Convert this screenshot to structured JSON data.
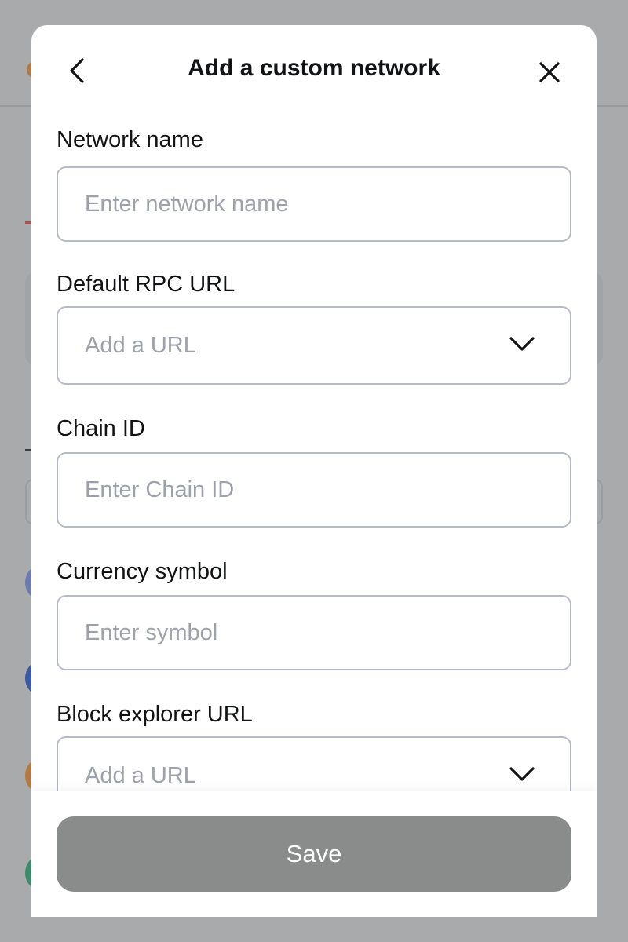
{
  "modal": {
    "title": "Add a custom network",
    "back_icon": "chevron-left-icon",
    "close_icon": "close-icon"
  },
  "fields": {
    "network_name": {
      "label": "Network name",
      "placeholder": "Enter network name",
      "value": ""
    },
    "rpc_url": {
      "label": "Default RPC URL",
      "value": "Add a URL",
      "icon": "chevron-down-icon"
    },
    "chain_id": {
      "label": "Chain ID",
      "placeholder": "Enter Chain ID",
      "value": ""
    },
    "currency_symbol": {
      "label": "Currency symbol",
      "placeholder": "Enter symbol",
      "value": ""
    },
    "block_explorer_url": {
      "label": "Block explorer URL",
      "value": "Add a URL",
      "icon": "chevron-down-icon"
    }
  },
  "footer": {
    "save_label": "Save"
  },
  "colors": {
    "overlay": "#a9aaab",
    "modal_bg": "#ffffff",
    "input_border": "#b7bbc8",
    "placeholder": "#9ca1ab",
    "save_button_bg": "#8a8c8c",
    "text": "#121314"
  }
}
